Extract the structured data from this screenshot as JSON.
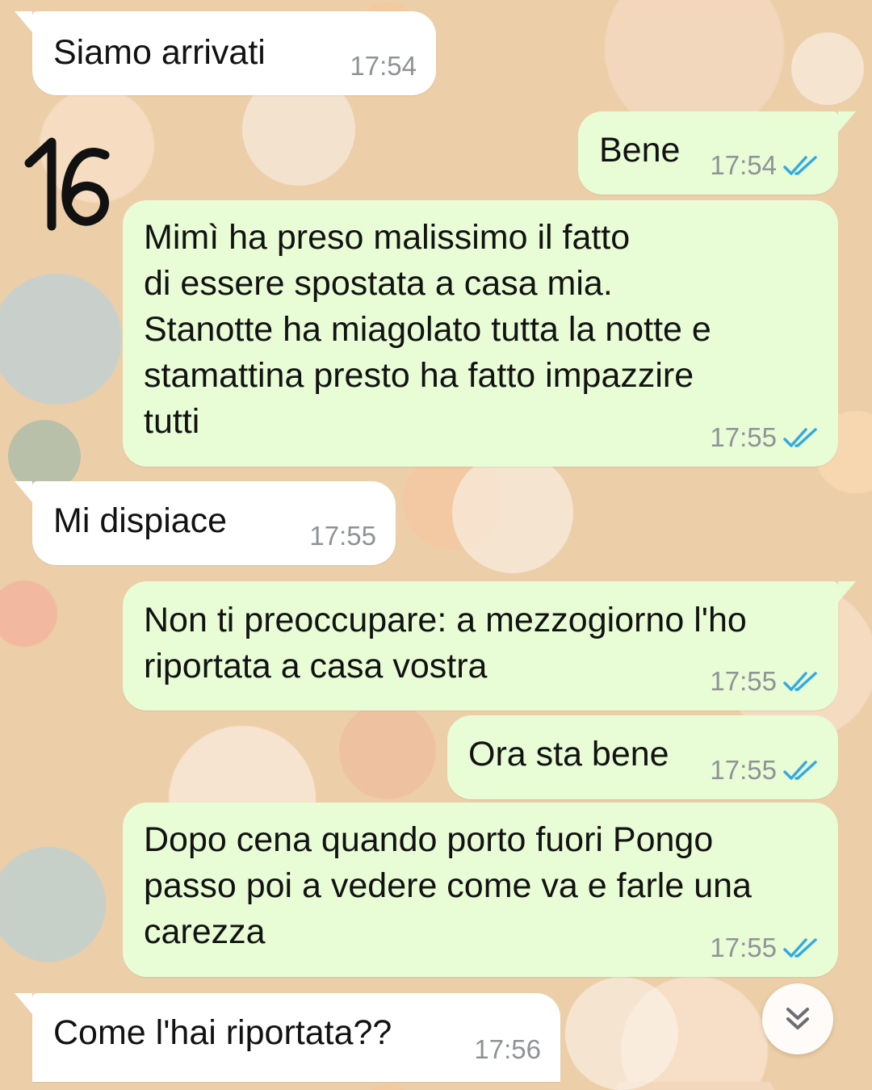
{
  "messages": [
    {
      "text": "Siamo arrivati",
      "time": "17:54"
    },
    {
      "text": "Bene",
      "time": "17:54",
      "status": "read"
    },
    {
      "text": "Mimì ha preso malissimo il fatto\ndi essere spostata a casa mia.\nStanotte ha miagolato tutta la notte e\nstamattina presto ha fatto impazzire\ntutti",
      "time": "17:55",
      "status": "read"
    },
    {
      "text": "Mi dispiace",
      "time": "17:55"
    },
    {
      "text": "Non ti preoccupare: a mezzogiorno l'ho\nriportata a casa vostra",
      "time": "17:55",
      "status": "read"
    },
    {
      "text": "Ora sta bene",
      "time": "17:55",
      "status": "read"
    },
    {
      "text": "Dopo cena quando porto fuori Pongo\npasso poi a vedere come va e farle una\ncarezza",
      "time": "17:55",
      "status": "read"
    },
    {
      "text": "Come l'hai riportata??",
      "time": "17:56"
    }
  ],
  "annotation": {
    "text": "16"
  },
  "icons": {
    "read_ticks": "double-check-icon",
    "scroll": "chevrons-down-icon"
  },
  "colors": {
    "incoming_bubble": "#ffffff",
    "outgoing_bubble": "#e8fcd6",
    "read_ticks": "#34aadf",
    "timestamp": "#8f9396",
    "message_text": "#121212"
  }
}
